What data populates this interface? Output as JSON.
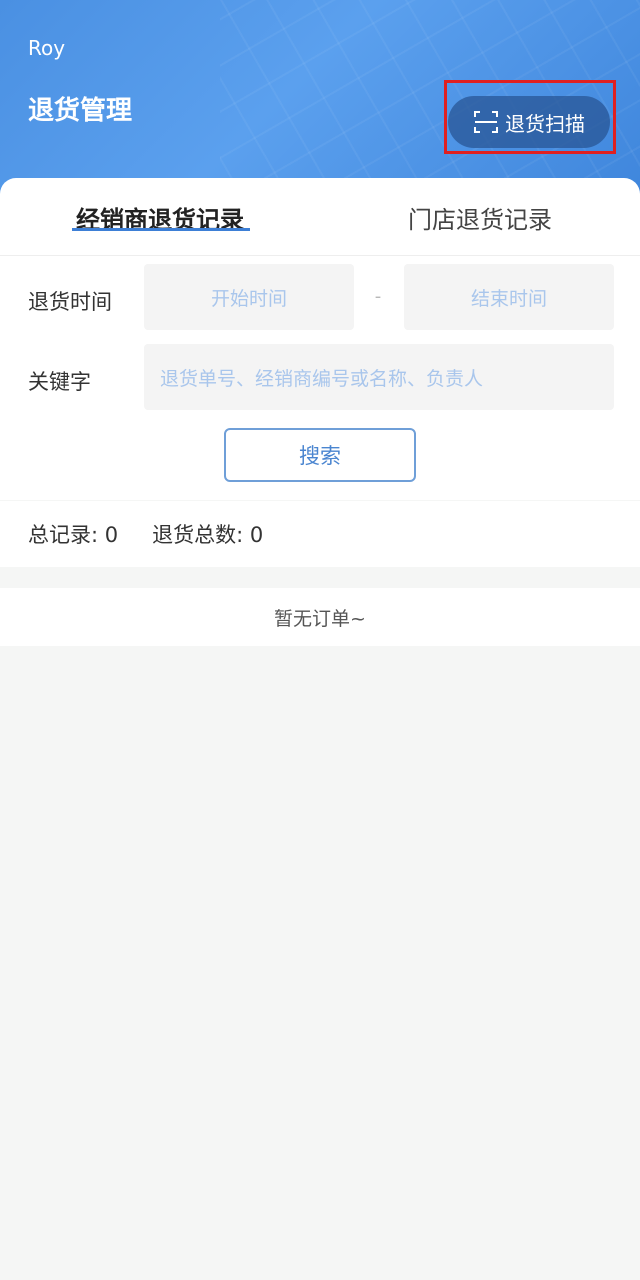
{
  "header": {
    "user_name": "Roy",
    "title": "退货管理",
    "scan_button_label": "退货扫描",
    "scan_icon": "scan-icon"
  },
  "tabs": [
    {
      "label": "经销商退货记录",
      "active": true
    },
    {
      "label": "门店退货记录",
      "active": false
    }
  ],
  "filters": {
    "time_label": "退货时间",
    "start_placeholder": "开始时间",
    "separator": "-",
    "end_placeholder": "结束时间",
    "keyword_label": "关键字",
    "keyword_placeholder": "退货单号、经销商编号或名称、负责人",
    "search_label": "搜索"
  },
  "summary": {
    "total_records": "总记录: 0",
    "total_returns": "退货总数: 0"
  },
  "empty_message": "暂无订单~",
  "colors": {
    "header_blue": "#4a90e2",
    "accent": "#3d7fd6",
    "highlight": "#e02020"
  }
}
